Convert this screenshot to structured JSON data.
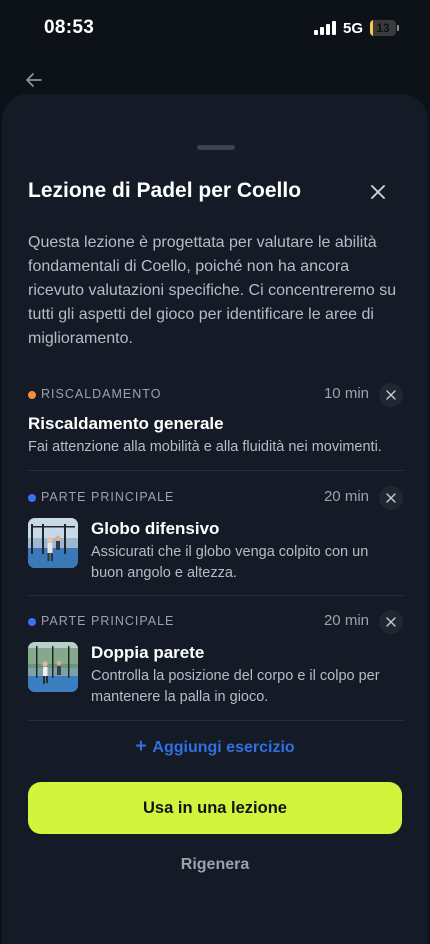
{
  "status_bar": {
    "time": "08:53",
    "network": "5G",
    "battery": "13",
    "battery_level": 0.13
  },
  "sheet": {
    "title": "Lezione di Padel per Coello",
    "description": "Questa lezione è progettata per valutare le abilità fondamentali di Coello, poiché non ha ancora ricevuto valutazioni specifiche. Ci concentreremo su tutti gli aspetti del gioco per identificare le aree di miglioramento."
  },
  "exercises": [
    {
      "category": "RISCALDAMENTO",
      "category_color": "#f0913a",
      "duration": "10 min",
      "name": "Riscaldamento generale",
      "text": "Fai attenzione alla mobilità e alla fluidità nei movimenti."
    },
    {
      "category": "PARTE PRINCIPALE",
      "category_color": "#3b6ff0",
      "duration": "20 min",
      "name": "Globo difensivo",
      "text": "Assicurati che il globo venga colpito con un buon angolo e altezza."
    },
    {
      "category": "PARTE PRINCIPALE",
      "category_color": "#3b6ff0",
      "duration": "20 min",
      "name": "Doppia parete",
      "text": "Controlla la posizione del corpo e il colpo per mantenere la palla in gioco."
    }
  ],
  "actions": {
    "add_plus": "+",
    "add_label": "Aggiungi esercizio",
    "use_label": "Usa in una lezione",
    "regenerate_label": "Rigenera"
  },
  "colors": {
    "accent": "#d2f43c",
    "link": "#2f6fe0",
    "sheet_bg": "#141b26",
    "page_bg": "#0d1118"
  },
  "icons": {
    "back": "arrow-left-icon",
    "close": "close-icon",
    "remove": "close-icon",
    "signal": "signal-icon",
    "battery": "battery-icon"
  }
}
